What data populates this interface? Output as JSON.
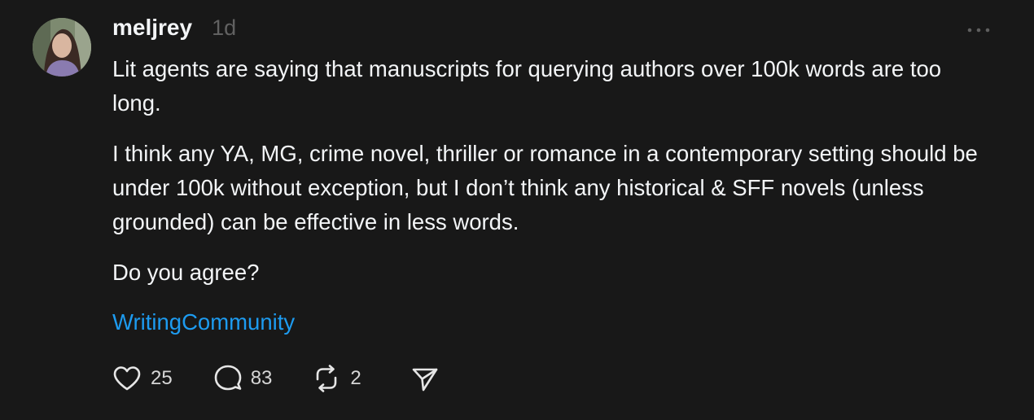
{
  "post": {
    "author": {
      "username": "meljrey",
      "avatar_icon": "profile-photo"
    },
    "timestamp": "1d",
    "more_icon": "ellipsis-icon",
    "paragraphs": [
      "Lit agents are saying that manuscripts for querying authors over 100k words are too long.",
      "I think any YA, MG, crime novel, thriller or romance in a contemporary setting should be under 100k without exception, but I don’t think any historical & SFF novels (unless grounded) can be effective in less words.",
      "Do you agree?"
    ],
    "topic_tag": "WritingCommunity",
    "actions": {
      "likes": "25",
      "replies": "83",
      "reposts": "2",
      "share_icon": "send-icon"
    }
  },
  "colors": {
    "background": "#181818",
    "text": "#f3f5f7",
    "muted": "#616161",
    "link": "#1d9bf0"
  }
}
